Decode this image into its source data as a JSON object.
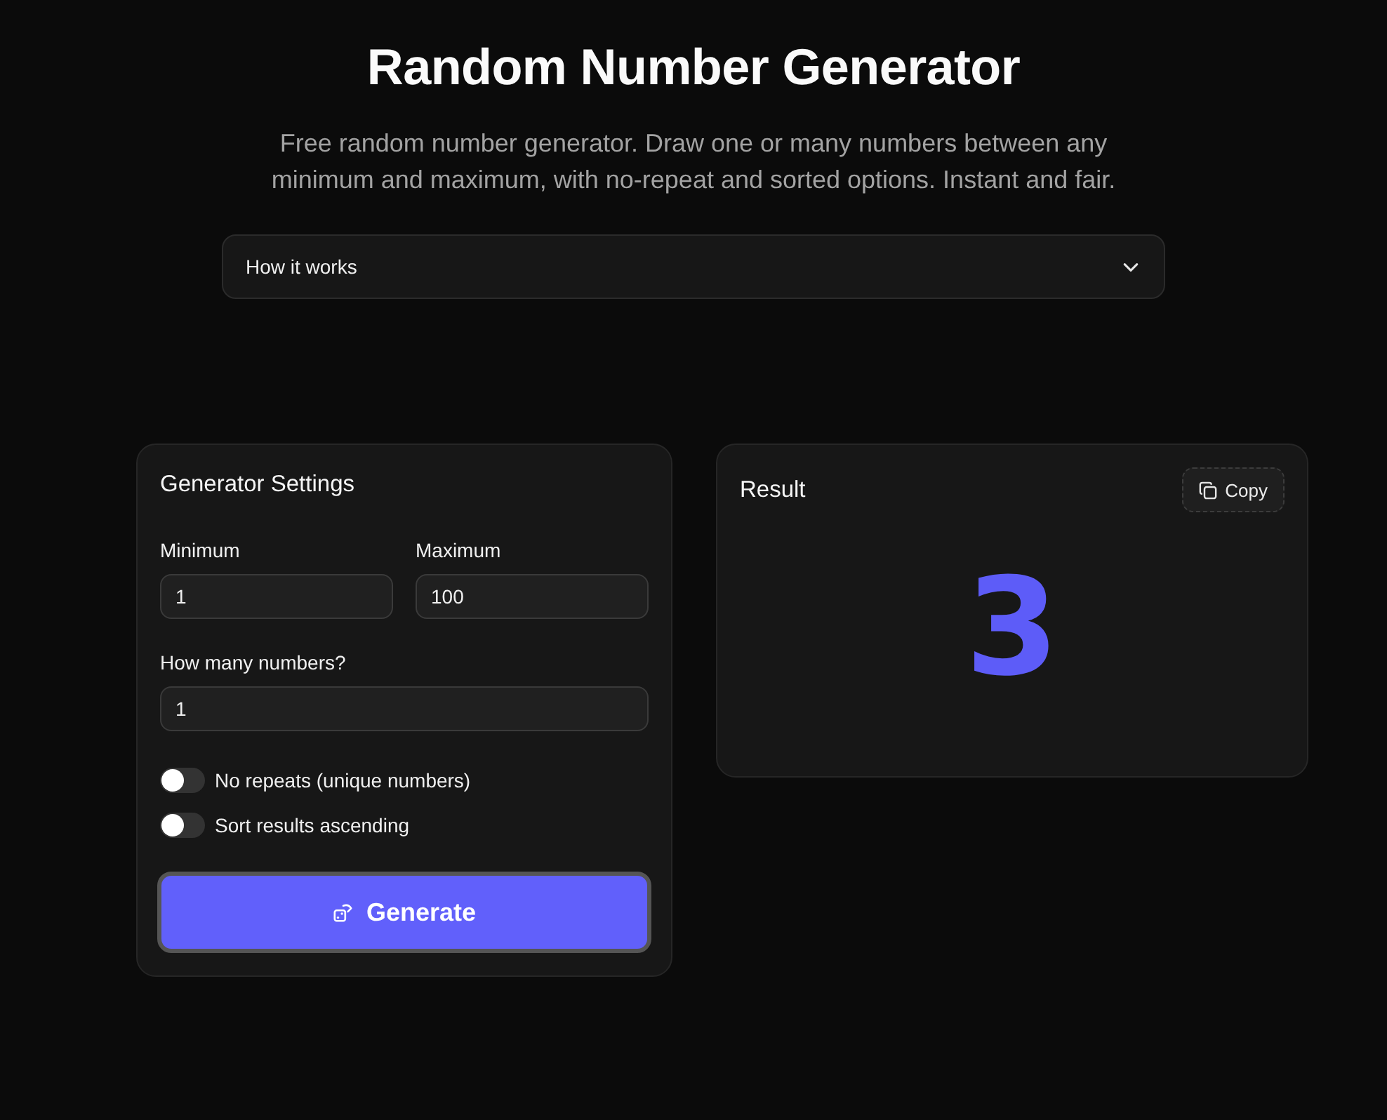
{
  "header": {
    "title": "Random Number Generator",
    "description": "Free random number generator. Draw one or many numbers between any minimum and maximum, with no-repeat and sorted options. Instant and fair."
  },
  "accordion": {
    "label": "How it works",
    "expanded": false
  },
  "settings": {
    "title": "Generator Settings",
    "range_fields": [
      {
        "label": "Minimum",
        "value": "1"
      },
      {
        "label": "Maximum",
        "value": "100"
      }
    ],
    "count_field": {
      "label": "How many numbers?",
      "value": "1"
    },
    "toggles": [
      {
        "label": "No repeats (unique numbers)",
        "on": false
      },
      {
        "label": "Sort results ascending",
        "on": false
      }
    ],
    "generate_button": "Generate"
  },
  "result": {
    "title": "Result",
    "copy_button": "Copy",
    "value": "3"
  }
}
